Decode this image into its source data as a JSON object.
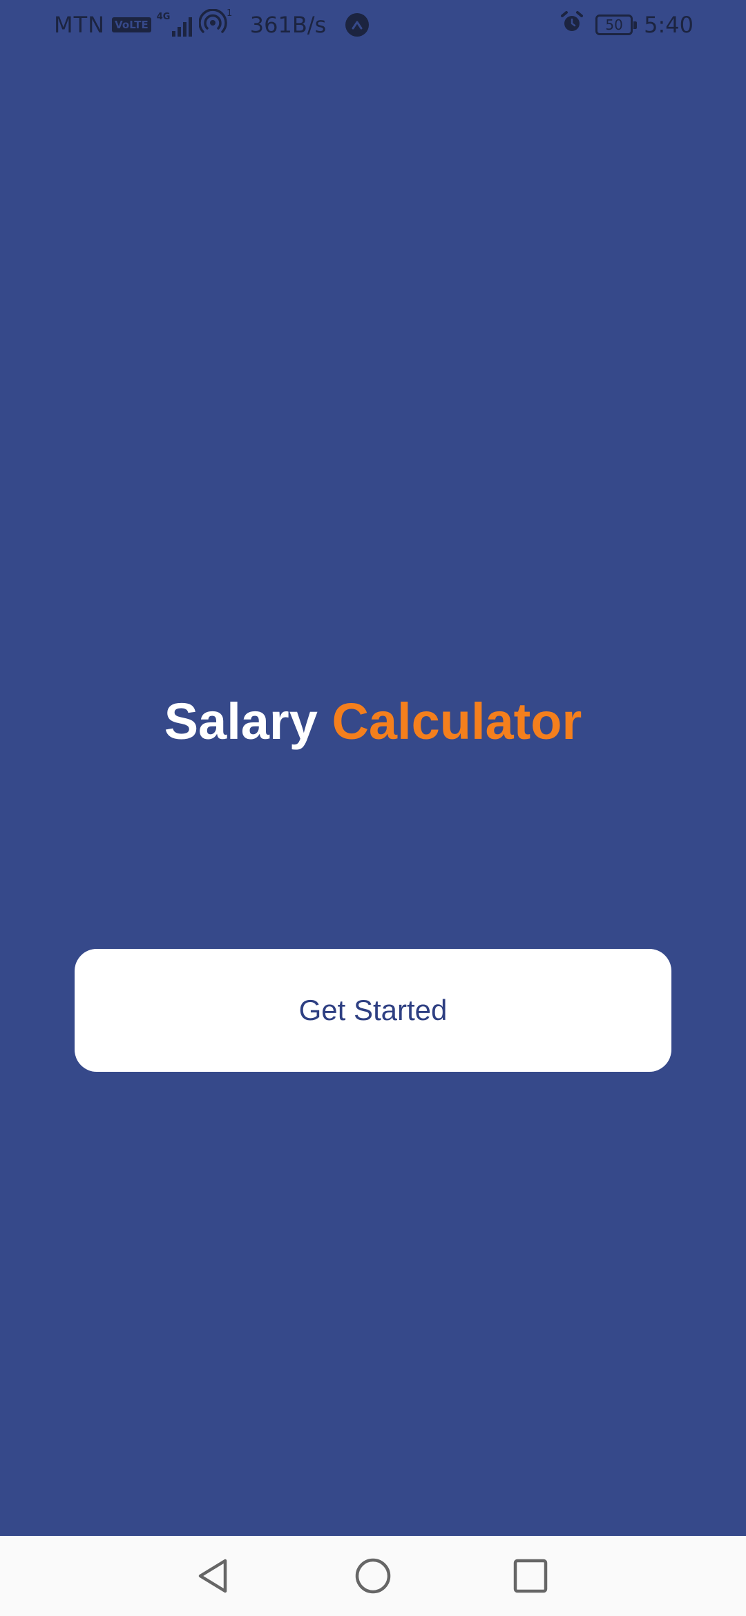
{
  "status_bar": {
    "carrier": "MTN",
    "volte_label": "VoLTE",
    "network_type": "4G",
    "hotspot_count": "1",
    "speed": "361B/s",
    "battery_level": "50",
    "time": "5:40",
    "icons": [
      "volte-icon",
      "signal-icon",
      "hotspot-icon",
      "app-notification-icon",
      "alarm-icon",
      "battery-icon"
    ]
  },
  "main": {
    "title_part1": "Salary",
    "title_part2": "Calculator",
    "button_label": "Get Started"
  },
  "nav_bar": {
    "icons": [
      "back-icon",
      "home-icon",
      "recents-icon"
    ]
  },
  "colors": {
    "background": "#36498a",
    "accent_orange": "#f47f1d",
    "button_bg": "#ffffff",
    "button_text": "#2e3f82",
    "status_text": "#1c2440",
    "nav_bg": "#fafafa"
  }
}
